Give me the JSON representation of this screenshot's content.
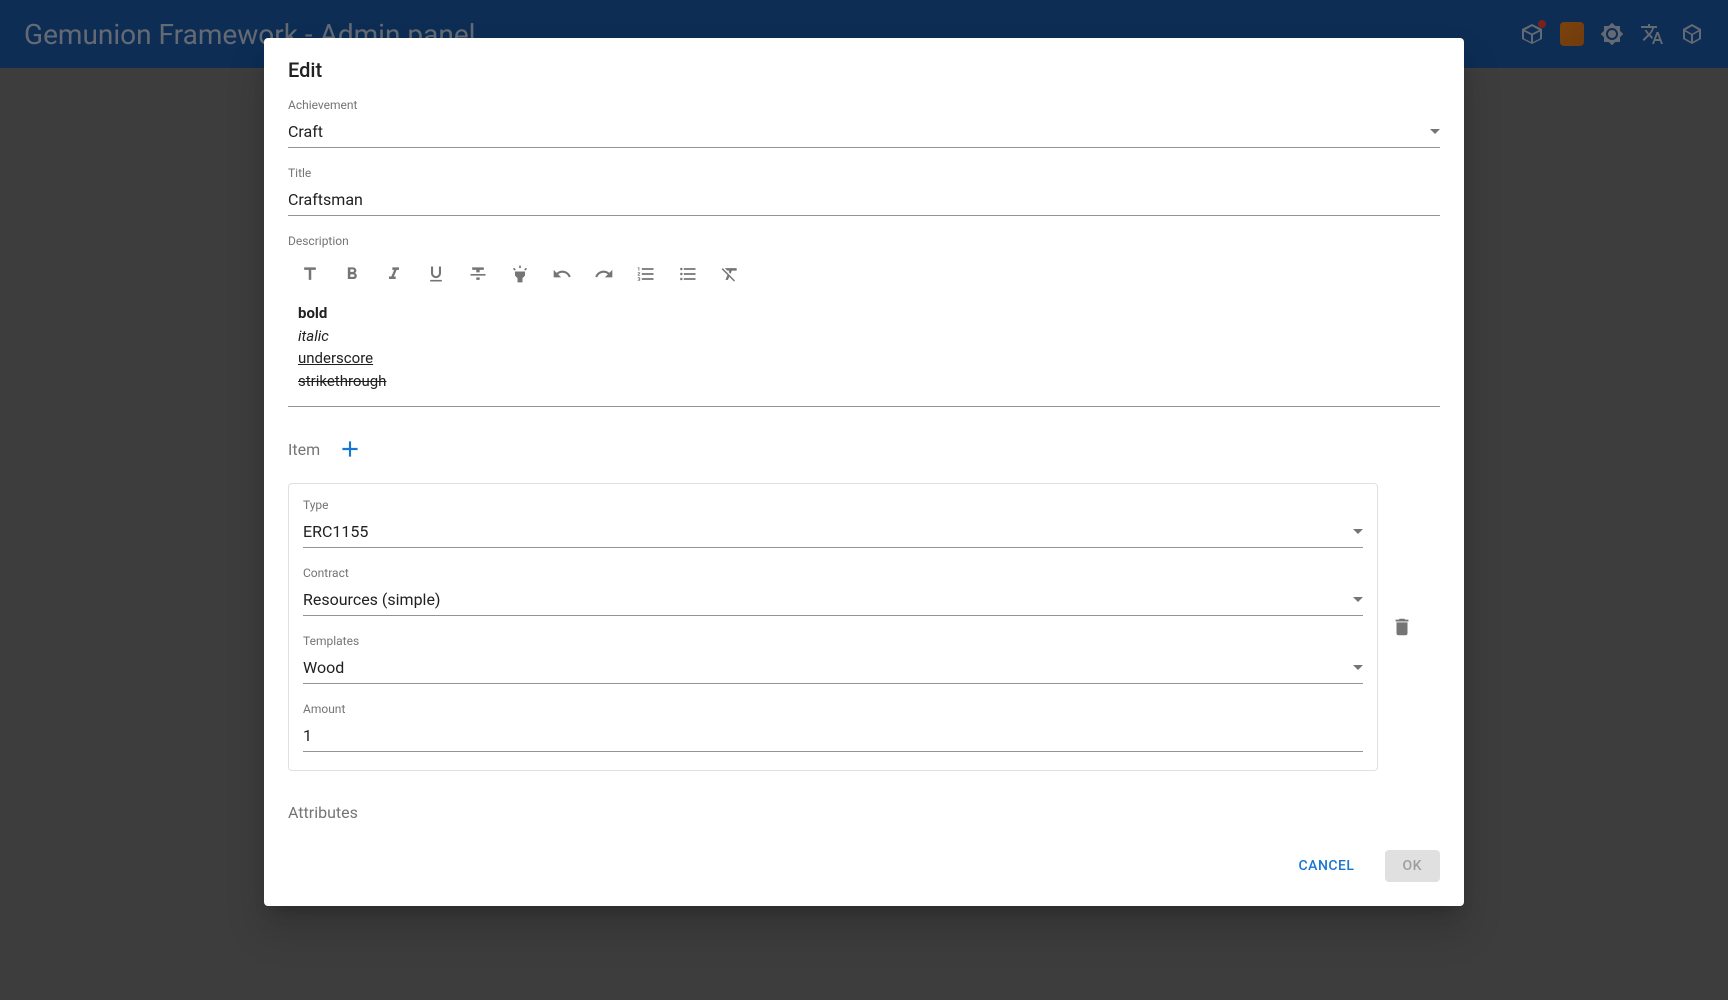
{
  "header": {
    "title": "Gemunion Framework - Admin panel"
  },
  "dialog": {
    "title": "Edit",
    "fields": {
      "achievement": {
        "label": "Achievement",
        "value": "Craft"
      },
      "title": {
        "label": "Title",
        "value": "Craftsman"
      },
      "description": {
        "label": "Description"
      }
    },
    "rte": {
      "bold": "bold",
      "italic": "italic",
      "underline": "underscore",
      "strike": "strikethrough"
    },
    "item_section": {
      "label": "Item"
    },
    "item": {
      "type": {
        "label": "Type",
        "value": "ERC1155"
      },
      "contract": {
        "label": "Contract",
        "value": "Resources (simple)"
      },
      "templates": {
        "label": "Templates",
        "value": "Wood"
      },
      "amount": {
        "label": "Amount",
        "value": "1"
      }
    },
    "attributes_label": "Attributes",
    "actions": {
      "cancel": "CANCEL",
      "ok": "OK"
    }
  }
}
